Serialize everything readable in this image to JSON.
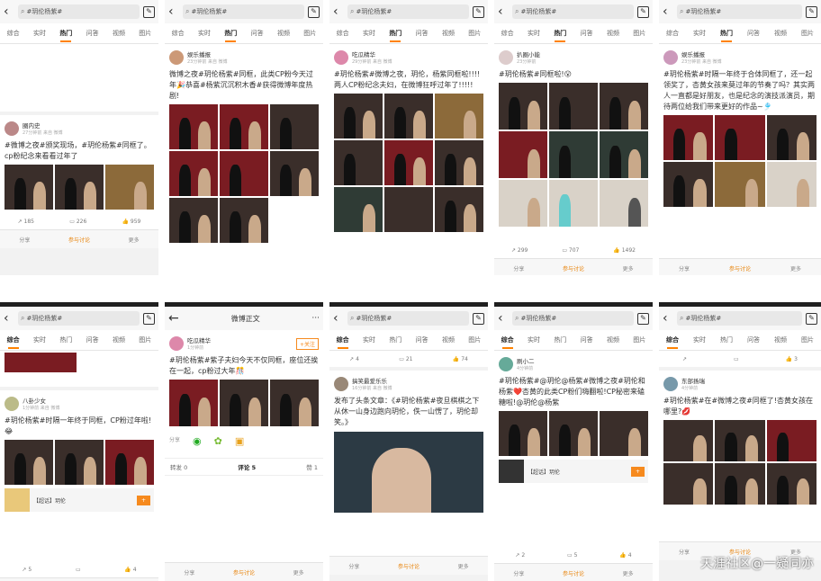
{
  "search": {
    "query": "#玥伦杨紫#"
  },
  "tabs": [
    "综合",
    "实时",
    "热门",
    "问答",
    "视频",
    "图片"
  ],
  "panels": [
    {
      "user": "圈内史",
      "meta": "27分钟前  来自 微博",
      "text": "#微博之夜#颁奖现场，#玥伦杨紫#同框了。cp粉纪念来看看过年了",
      "counts": [
        "185",
        "226",
        "959"
      ]
    },
    {
      "user": "娱乐播报",
      "meta": "23分钟前  来自 微博",
      "text": "微博之夜#玥伦杨紫#同框，此类CP粉今天过年🎉恭喜#杨紫沉沉积木香#获得微博年度热剧!"
    },
    {
      "user": "吃瓜精华",
      "meta": "29分钟前  来自 微博",
      "text": "#玥伦杨紫#微博之夜，玥伦，杨紫同框啦!!!!两人CP粉纪念夫妇，在微博狂呼过年了!!!!!"
    },
    {
      "user": "扒圈小能",
      "meta": "23分钟前",
      "text": "#玥伦杨紫#同框啦!😮",
      "counts": [
        "299",
        "707",
        "1492"
      ]
    },
    {
      "user": "娱乐播报",
      "meta": "23分钟前  来自 微博",
      "text": "#玥伦杨紫#时隔一年终于合体同框了，还一起领奖了，杏黄女孩来莫过年的节奏了吗？其实两人一直都是好朋友，也是纪念的演技派演员，期待两位给我们带来更好的作品~🎐"
    },
    {
      "user": "八卦少女",
      "meta": "1分钟前  来自 微博",
      "text": "#玥伦杨紫#时隔一年终于同框，CP粉过年啦!😂",
      "counts": [
        "5",
        "",
        "4"
      ],
      "ad_title": "【超话】玥伦"
    },
    {
      "title": "微博正文",
      "user": "吃瓜精华",
      "meta": "1分钟前",
      "text": "#玥伦杨紫#紫子夫妇今天不仅同框，座位还挨在一起，cp粉过大年🎊",
      "follow": "+关注",
      "tabs": [
        "转发 0",
        "评论 5",
        "赞 1"
      ]
    },
    {
      "user": "搞笑最爱乐乐",
      "meta": "16分钟前  来自 微博",
      "text": "发布了头条文章：《#玥伦杨紫#夜旦棋棋之下从休一山身边跑向玥伦，佚一山愣了，玥伦却笑。》",
      "counts": [
        "4",
        "21",
        "74"
      ]
    },
    {
      "user": "刷小二",
      "meta": "4分钟前",
      "text": "#玥伦杨紫#@玥伦@杨紫#微博之夜#玥伦和杨紫❤️杏黄的此类CP粉们嗨翻啦!CP秘密来磕糖啦!@玥伦@杨紫",
      "ad_title": "【超话】玥伦",
      "counts": [
        "2",
        "5",
        "4"
      ]
    },
    {
      "user": "东部扬瑞",
      "meta": "4分钟前",
      "text": "#玥伦杨紫#在#微博之夜#同框了!杏黄女孩在哪里?💋",
      "counts": [
        "",
        "",
        "3"
      ]
    }
  ],
  "actions": {
    "share": "分享",
    "comment": "参与讨论",
    "more": "更多"
  },
  "watermark": "天涯社区@一疑同亦"
}
